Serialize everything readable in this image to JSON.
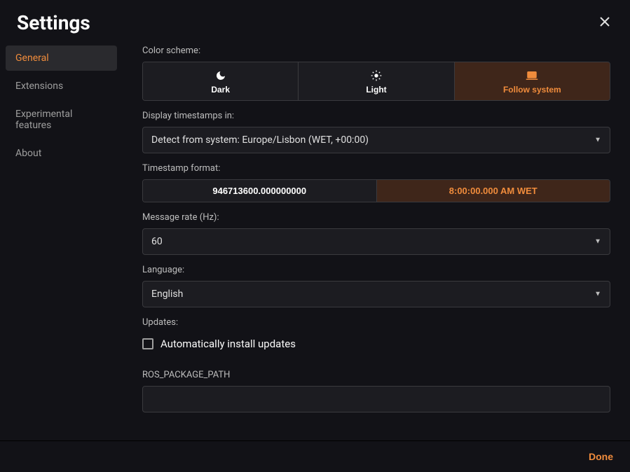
{
  "title": "Settings",
  "sidebar": {
    "items": [
      {
        "label": "General",
        "active": true
      },
      {
        "label": "Extensions",
        "active": false
      },
      {
        "label": "Experimental features",
        "active": false
      },
      {
        "label": "About",
        "active": false
      }
    ]
  },
  "general": {
    "color_scheme_label": "Color scheme:",
    "color_scheme_options": {
      "dark": "Dark",
      "light": "Light",
      "follow": "Follow system"
    },
    "color_scheme_selected": "follow",
    "timestamps_label": "Display timestamps in:",
    "timestamps_value": "Detect from system: Europe/Lisbon (WET, +00:00)",
    "timestamp_format_label": "Timestamp format:",
    "timestamp_format_options": {
      "raw": "946713600.000000000",
      "formatted": "8:00:00.000 AM WET"
    },
    "timestamp_format_selected": "formatted",
    "message_rate_label": "Message rate (Hz):",
    "message_rate_value": "60",
    "language_label": "Language:",
    "language_value": "English",
    "updates_label": "Updates:",
    "auto_install_label": "Automatically install updates",
    "auto_install_checked": false,
    "ros_path_label": "ROS_PACKAGE_PATH",
    "ros_path_value": ""
  },
  "footer": {
    "done": "Done"
  }
}
